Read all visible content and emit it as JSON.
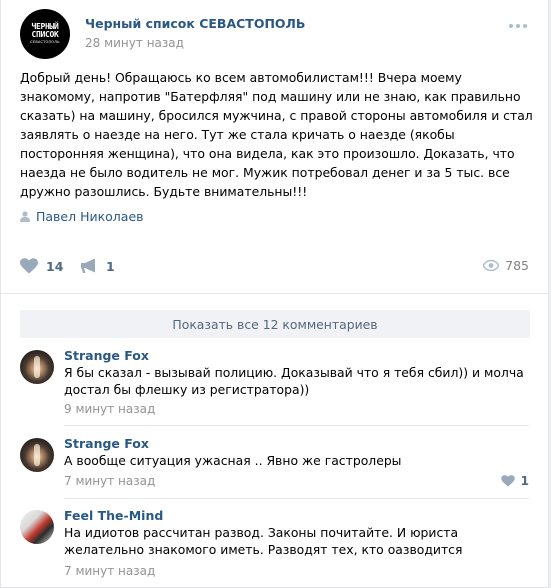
{
  "post": {
    "group_name": "Черный список СЕВАСТОПОЛЬ",
    "time": "28 минут назад",
    "avatar_text": {
      "line1": "ЧЕРНЫЙ",
      "line2": "СПИСОК",
      "line3": "СЕВАСТОПОЛЬ"
    },
    "text": "Добрый день! Обращаюсь ко всем автомобилистам!!! Вчера моему знакомому, напротив \"Батерфляя\" под машину или не знаю, как правильно сказать) на машину, бросился мужчина, с правой стороны автомобиля и стал заявлять о наезде на него. Тут же стала кричать о наезде (якобы посторонняя женщина), что она видела, как это произошло. Доказать, что наезда не было водитель не мог. Мужик потребовал денег и за 5 тыс. все дружно разошлись. Будьте внимательны!!!",
    "signer": "Павел Николаев",
    "likes": "14",
    "shares": "1",
    "views": "785"
  },
  "comments_block": {
    "show_all_label": "Показать все 12 комментариев",
    "items": [
      {
        "author": "Strange Fox",
        "text": "Я бы сказал - вызывай полицию. Доказывай что я тебя сбил)) и молча достал бы флешку из регистратора))",
        "time": "9 минут назад",
        "likes": ""
      },
      {
        "author": "Strange Fox",
        "text": "А вообще ситуация ужасная .. Явно же гастролеры",
        "time": "7 минут назад",
        "likes": "1"
      },
      {
        "author": "Feel The-Mind",
        "text": "На идиотов рассчитан развод. Законы почитайте. И юриста желательно знакомого иметь. Разводят тех, кто оазводится",
        "time": "7 минут назад",
        "likes": ""
      }
    ]
  },
  "icons": {
    "more": "more-dots-icon",
    "signer": "user-icon",
    "like": "heart-icon",
    "share": "megaphone-icon",
    "views": "eye-icon"
  },
  "colors": {
    "link": "#2a5885",
    "action": "#4f6a87",
    "meta": "#939393",
    "icon": "#aebccb"
  }
}
